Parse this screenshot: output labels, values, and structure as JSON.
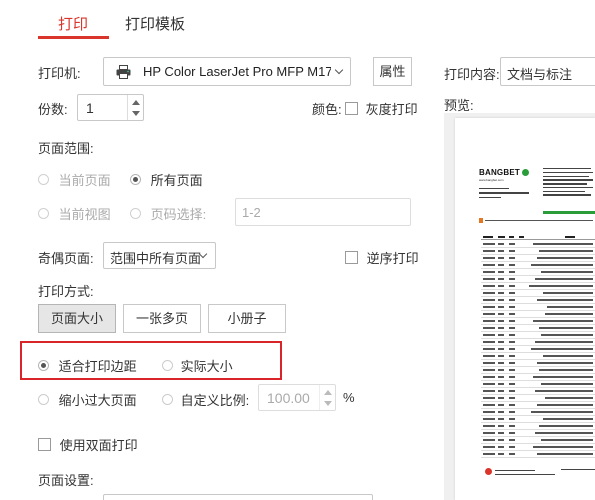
{
  "tabs": [
    {
      "label": "打印",
      "active": true
    },
    {
      "label": "打印模板",
      "active": false
    }
  ],
  "printer": {
    "label": "打印机:",
    "name": "HP Color LaserJet Pro MFP M17",
    "properties_label": "属性"
  },
  "copies": {
    "label": "份数:",
    "value": "1"
  },
  "color": {
    "label": "颜色:",
    "grayscale_label": "灰度打印",
    "grayscale_checked": false
  },
  "page_range": {
    "label": "页面范围:",
    "current_page": "当前页面",
    "all_pages": "所有页面",
    "current_view": "当前视图",
    "page_select": "页码选择:",
    "page_select_placeholder": "1-2",
    "selected": "all_pages"
  },
  "odd_even": {
    "label": "奇偶页面:",
    "value": "范围中所有页面",
    "reverse_label": "逆序打印",
    "reverse_checked": false
  },
  "print_mode": {
    "label": "打印方式:",
    "buttons": [
      "页面大小",
      "一张多页",
      "小册子"
    ],
    "selected": "页面大小"
  },
  "scaling": {
    "fit_margins": "适合打印边距",
    "actual_size": "实际大小",
    "shrink_large": "缩小过大页面",
    "custom_scale": "自定义比例:",
    "custom_value": "100.00",
    "percent": "%",
    "selected": "fit_margins"
  },
  "duplex": {
    "label": "使用双面打印",
    "checked": false
  },
  "page_settings": {
    "label": "页面设置:"
  },
  "print_content": {
    "label": "打印内容:",
    "value": "文档与标注"
  },
  "preview": {
    "label": "预览:",
    "brand": "BANGBET",
    "url": "www.bangbet.com",
    "colors": {
      "accent": "#d9352a",
      "brand_green": "#2a9d3a"
    }
  },
  "icons": {
    "printer": "printer-icon",
    "dropdown": "chevron-down-icon"
  }
}
